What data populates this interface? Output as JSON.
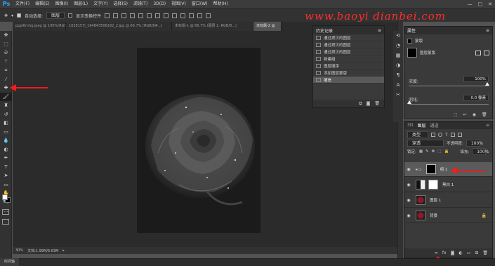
{
  "app": {
    "logo": "Ps"
  },
  "menubar": {
    "items": [
      "文件(F)",
      "编辑(E)",
      "图像(I)",
      "图层(L)",
      "文字(Y)",
      "选择(S)",
      "滤镜(T)",
      "3D(D)",
      "视图(V)",
      "窗口(W)",
      "帮助(H)"
    ],
    "window_controls": [
      "—",
      "□",
      "✕"
    ]
  },
  "options": {
    "auto_select_label": "自动选择:",
    "auto_select_value": "图层",
    "show_transform_label": "显示变换控件",
    "watermark": "www.baoyi dianbei.com"
  },
  "doctabs": [
    {
      "label": "pppl6mhg.jpeg @ 100%(RGB/8#...)",
      "active": false
    },
    {
      "label": "1028157l_164843506182_2.jpg @ 66.7% (RGB/8#...)",
      "active": false
    },
    {
      "label": "未标题-1 @ 66.7% (图层 2, RGB/8...)",
      "active": false
    },
    {
      "label": "未标题-2 @",
      "active": true
    }
  ],
  "history": {
    "title": "历史记录",
    "items": [
      "通过拷贝的图层",
      "通过拷贝的图层",
      "通过拷贝的图层",
      "新建组",
      "图层顺序",
      "添加图层蒙版",
      "填充"
    ],
    "active_index": 6
  },
  "properties": {
    "title": "属性",
    "mask_type_label": "蒙版",
    "layer_mask_label": "图层蒙版",
    "density_label": "浓度:",
    "density_value": "100%",
    "feather_label": "羽化:",
    "feather_value": "0.0 像素"
  },
  "layers_panel": {
    "tabs": [
      "3D",
      "图层",
      "通道"
    ],
    "active_tab": "图层",
    "filter_kind": "类型",
    "blend_mode": "穿透",
    "opacity_label": "不透明度:",
    "opacity_value": "100%",
    "lock_label": "锁定:",
    "fill_label": "填充:",
    "fill_value": "100%",
    "layers": [
      {
        "name": "组 1",
        "type": "group",
        "selected": true
      },
      {
        "name": "黑白 1",
        "type": "adjustment",
        "selected": false
      },
      {
        "name": "图层 1",
        "type": "pixel",
        "selected": false
      },
      {
        "name": "背景",
        "type": "background",
        "selected": false
      }
    ]
  },
  "status": {
    "zoom": "30%",
    "doc_size": "文档:1.99M/6.63M"
  },
  "bottom": {
    "timeline_label": "时间轴"
  },
  "colors": {
    "arrow": "#ff1a1a",
    "accent": "#31a8ff",
    "thumb_red": "#8b1a2b"
  }
}
